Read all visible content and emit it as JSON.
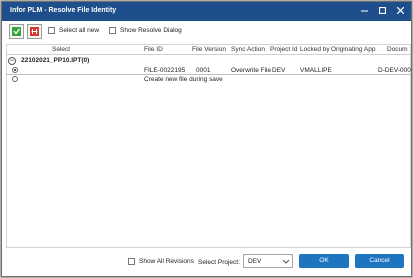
{
  "window": {
    "title": "Infor PLM - Resolve File Identity",
    "accent_color": "#1e4f8c"
  },
  "toolbar": {
    "icon1": "add-file-icon",
    "icon2": "remove-file-icon",
    "select_all_label": "Select all new",
    "show_resolve_label": "Show Resolve Dialog"
  },
  "grid": {
    "columns": [
      "Select",
      "File ID",
      "File Version",
      "Sync Action",
      "Project Id",
      "Locked by",
      "Originating App",
      "Docum"
    ],
    "group_label": "22102021_PP10.IPT(0)",
    "rows": [
      {
        "selected": true,
        "file_id": "FILE-0022195",
        "file_version": "0001",
        "sync_action": "Overwrite File",
        "project_id": "DEV",
        "locked_by": "VMALLIPE",
        "originating_app": "",
        "document": "D-DEV-000"
      },
      {
        "selected": false,
        "text": "Create new file during save"
      }
    ]
  },
  "footer": {
    "show_all_revisions_label": "Show All Revisions",
    "select_project_label": "Select Project:",
    "project_value": "DEV",
    "ok_label": "OK",
    "cancel_label": "Cancel",
    "button_color": "#1f74c0"
  }
}
